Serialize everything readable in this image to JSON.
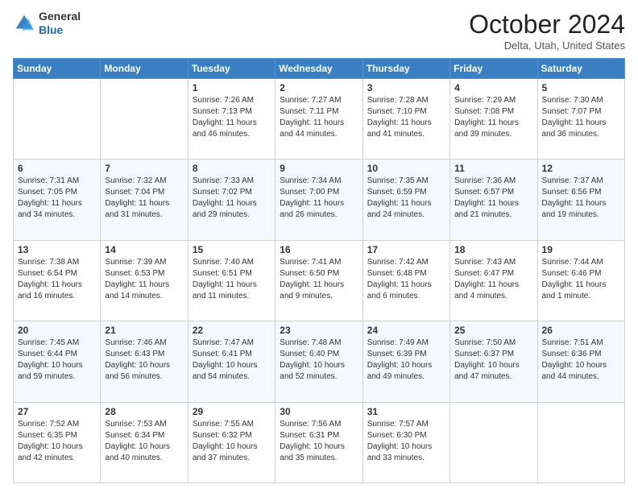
{
  "header": {
    "logo_general": "General",
    "logo_blue": "Blue",
    "month_title": "October 2024",
    "subtitle": "Delta, Utah, United States"
  },
  "weekdays": [
    "Sunday",
    "Monday",
    "Tuesday",
    "Wednesday",
    "Thursday",
    "Friday",
    "Saturday"
  ],
  "weeks": [
    [
      {
        "day": "",
        "sunrise": "",
        "sunset": "",
        "daylight": ""
      },
      {
        "day": "",
        "sunrise": "",
        "sunset": "",
        "daylight": ""
      },
      {
        "day": "1",
        "sunrise": "Sunrise: 7:26 AM",
        "sunset": "Sunset: 7:13 PM",
        "daylight": "Daylight: 11 hours and 46 minutes."
      },
      {
        "day": "2",
        "sunrise": "Sunrise: 7:27 AM",
        "sunset": "Sunset: 7:11 PM",
        "daylight": "Daylight: 11 hours and 44 minutes."
      },
      {
        "day": "3",
        "sunrise": "Sunrise: 7:28 AM",
        "sunset": "Sunset: 7:10 PM",
        "daylight": "Daylight: 11 hours and 41 minutes."
      },
      {
        "day": "4",
        "sunrise": "Sunrise: 7:29 AM",
        "sunset": "Sunset: 7:08 PM",
        "daylight": "Daylight: 11 hours and 39 minutes."
      },
      {
        "day": "5",
        "sunrise": "Sunrise: 7:30 AM",
        "sunset": "Sunset: 7:07 PM",
        "daylight": "Daylight: 11 hours and 36 minutes."
      }
    ],
    [
      {
        "day": "6",
        "sunrise": "Sunrise: 7:31 AM",
        "sunset": "Sunset: 7:05 PM",
        "daylight": "Daylight: 11 hours and 34 minutes."
      },
      {
        "day": "7",
        "sunrise": "Sunrise: 7:32 AM",
        "sunset": "Sunset: 7:04 PM",
        "daylight": "Daylight: 11 hours and 31 minutes."
      },
      {
        "day": "8",
        "sunrise": "Sunrise: 7:33 AM",
        "sunset": "Sunset: 7:02 PM",
        "daylight": "Daylight: 11 hours and 29 minutes."
      },
      {
        "day": "9",
        "sunrise": "Sunrise: 7:34 AM",
        "sunset": "Sunset: 7:00 PM",
        "daylight": "Daylight: 11 hours and 26 minutes."
      },
      {
        "day": "10",
        "sunrise": "Sunrise: 7:35 AM",
        "sunset": "Sunset: 6:59 PM",
        "daylight": "Daylight: 11 hours and 24 minutes."
      },
      {
        "day": "11",
        "sunrise": "Sunrise: 7:36 AM",
        "sunset": "Sunset: 6:57 PM",
        "daylight": "Daylight: 11 hours and 21 minutes."
      },
      {
        "day": "12",
        "sunrise": "Sunrise: 7:37 AM",
        "sunset": "Sunset: 6:56 PM",
        "daylight": "Daylight: 11 hours and 19 minutes."
      }
    ],
    [
      {
        "day": "13",
        "sunrise": "Sunrise: 7:38 AM",
        "sunset": "Sunset: 6:54 PM",
        "daylight": "Daylight: 11 hours and 16 minutes."
      },
      {
        "day": "14",
        "sunrise": "Sunrise: 7:39 AM",
        "sunset": "Sunset: 6:53 PM",
        "daylight": "Daylight: 11 hours and 14 minutes."
      },
      {
        "day": "15",
        "sunrise": "Sunrise: 7:40 AM",
        "sunset": "Sunset: 6:51 PM",
        "daylight": "Daylight: 11 hours and 11 minutes."
      },
      {
        "day": "16",
        "sunrise": "Sunrise: 7:41 AM",
        "sunset": "Sunset: 6:50 PM",
        "daylight": "Daylight: 11 hours and 9 minutes."
      },
      {
        "day": "17",
        "sunrise": "Sunrise: 7:42 AM",
        "sunset": "Sunset: 6:48 PM",
        "daylight": "Daylight: 11 hours and 6 minutes."
      },
      {
        "day": "18",
        "sunrise": "Sunrise: 7:43 AM",
        "sunset": "Sunset: 6:47 PM",
        "daylight": "Daylight: 11 hours and 4 minutes."
      },
      {
        "day": "19",
        "sunrise": "Sunrise: 7:44 AM",
        "sunset": "Sunset: 6:46 PM",
        "daylight": "Daylight: 11 hours and 1 minute."
      }
    ],
    [
      {
        "day": "20",
        "sunrise": "Sunrise: 7:45 AM",
        "sunset": "Sunset: 6:44 PM",
        "daylight": "Daylight: 10 hours and 59 minutes."
      },
      {
        "day": "21",
        "sunrise": "Sunrise: 7:46 AM",
        "sunset": "Sunset: 6:43 PM",
        "daylight": "Daylight: 10 hours and 56 minutes."
      },
      {
        "day": "22",
        "sunrise": "Sunrise: 7:47 AM",
        "sunset": "Sunset: 6:41 PM",
        "daylight": "Daylight: 10 hours and 54 minutes."
      },
      {
        "day": "23",
        "sunrise": "Sunrise: 7:48 AM",
        "sunset": "Sunset: 6:40 PM",
        "daylight": "Daylight: 10 hours and 52 minutes."
      },
      {
        "day": "24",
        "sunrise": "Sunrise: 7:49 AM",
        "sunset": "Sunset: 6:39 PM",
        "daylight": "Daylight: 10 hours and 49 minutes."
      },
      {
        "day": "25",
        "sunrise": "Sunrise: 7:50 AM",
        "sunset": "Sunset: 6:37 PM",
        "daylight": "Daylight: 10 hours and 47 minutes."
      },
      {
        "day": "26",
        "sunrise": "Sunrise: 7:51 AM",
        "sunset": "Sunset: 6:36 PM",
        "daylight": "Daylight: 10 hours and 44 minutes."
      }
    ],
    [
      {
        "day": "27",
        "sunrise": "Sunrise: 7:52 AM",
        "sunset": "Sunset: 6:35 PM",
        "daylight": "Daylight: 10 hours and 42 minutes."
      },
      {
        "day": "28",
        "sunrise": "Sunrise: 7:53 AM",
        "sunset": "Sunset: 6:34 PM",
        "daylight": "Daylight: 10 hours and 40 minutes."
      },
      {
        "day": "29",
        "sunrise": "Sunrise: 7:55 AM",
        "sunset": "Sunset: 6:32 PM",
        "daylight": "Daylight: 10 hours and 37 minutes."
      },
      {
        "day": "30",
        "sunrise": "Sunrise: 7:56 AM",
        "sunset": "Sunset: 6:31 PM",
        "daylight": "Daylight: 10 hours and 35 minutes."
      },
      {
        "day": "31",
        "sunrise": "Sunrise: 7:57 AM",
        "sunset": "Sunset: 6:30 PM",
        "daylight": "Daylight: 10 hours and 33 minutes."
      },
      {
        "day": "",
        "sunrise": "",
        "sunset": "",
        "daylight": ""
      },
      {
        "day": "",
        "sunrise": "",
        "sunset": "",
        "daylight": ""
      }
    ]
  ]
}
